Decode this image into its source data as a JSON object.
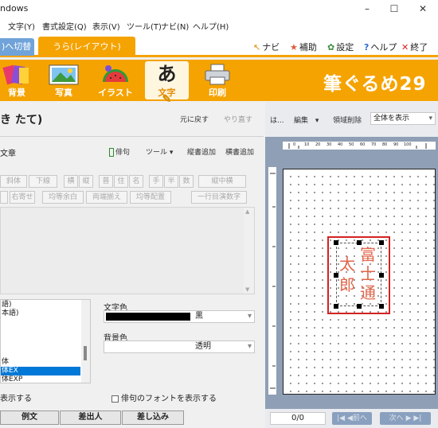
{
  "window": {
    "title": "ndows",
    "controls": {
      "minimize": "–",
      "maximize": "☐",
      "close": "✕"
    }
  },
  "menu": [
    "文字(Y)",
    "書式設定(Q)",
    "表示(V)",
    "ツール(T)",
    "ナビ(N)",
    "ヘルプ(H)"
  ],
  "tabs": {
    "switch_label": ")へ切替",
    "layout_label": "うら(レイアウト)"
  },
  "top_links": {
    "navi": "ナビ",
    "hojo": "補助",
    "settings": "設定",
    "help": "ヘルプ",
    "exit": "終了"
  },
  "ribbon": {
    "bg": "背景",
    "photo": "写真",
    "illust": "イラスト",
    "text": "文字",
    "print": "印刷",
    "brand": "筆ぐるめ29"
  },
  "panel": {
    "title": "き たて)",
    "undo": "元に戻す",
    "redo": "やり直す",
    "subsection": "文章",
    "haiku": "俳句",
    "tools": "ツール",
    "add_vertical": "縦書追加",
    "add_horizontal": "横書追加"
  },
  "format_buttons": {
    "row1": [
      "斜体",
      "下線",
      "横",
      "縦",
      "普",
      "住",
      "名",
      "手",
      "半",
      "数",
      "縦中横"
    ],
    "row2": [
      "右寄せ",
      "均等余白",
      "両端揃え",
      "均等配置",
      "一行目演数字"
    ]
  },
  "font_list": [
    "語)",
    "本語)",
    "体",
    "体EX",
    "体EXP"
  ],
  "font_list_selected": 3,
  "text_color": {
    "label": "文字色",
    "value": "黒",
    "swatch": "#000000"
  },
  "bg_color": {
    "label": "背景色",
    "value": "透明"
  },
  "checkboxes": {
    "show_left": "表示する",
    "show_haiku_font": "俳句のフォントを表示する"
  },
  "bottom_tabs": [
    "例文",
    "差出人",
    "差し込み"
  ],
  "right": {
    "ha": "は...",
    "edit": "編集",
    "delete_area": "領域削除",
    "zoom": "全体を表示",
    "ruler_marks": [
      "0",
      "10",
      "20",
      "30",
      "40",
      "50",
      "60",
      "70",
      "80",
      "90",
      "100"
    ],
    "vtext_left": [
      "太",
      "郎"
    ],
    "vtext_right": [
      "富",
      "士",
      "通"
    ],
    "page_count": "0/0",
    "prev": "前へ",
    "next": "次へ"
  },
  "colors": {
    "accent_orange": "#f5a300",
    "vtext": "#e0664a",
    "selection": "#d32222",
    "preview_bg": "#8f9fb5"
  }
}
